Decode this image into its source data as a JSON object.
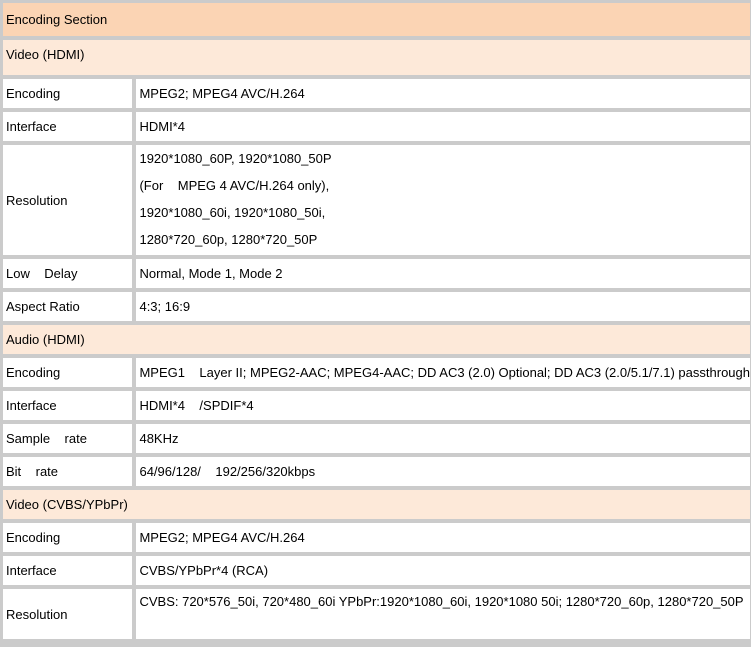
{
  "title": "Encoding Section",
  "sections": [
    {
      "heading": "Video (HDMI)",
      "rows": [
        {
          "label": "Encoding",
          "value": "MPEG2; MPEG4 AVC/H.264"
        },
        {
          "label": "Interface",
          "value": "HDMI*4"
        },
        {
          "label": "Resolution",
          "value_lines": [
            "1920*1080_60P, 1920*1080_50P",
            "(For    MPEG 4 AVC/H.264 only),",
            "1920*1080_60i, 1920*1080_50i,",
            "1280*720_60p, 1280*720_50P"
          ]
        },
        {
          "label": "Low    Delay",
          "value": "Normal, Mode 1, Mode 2"
        },
        {
          "label": "Aspect Ratio",
          "value": "4:3; 16:9"
        }
      ]
    },
    {
      "heading": "Audio (HDMI)",
      "rows": [
        {
          "label": "Encoding",
          "value": "MPEG1    Layer II; MPEG2-AAC; MPEG4-AAC; DD AC3 (2.0) Optional; DD AC3 (2.0/5.1/7.1) passthrough"
        },
        {
          "label": "Interface",
          "value": "HDMI*4    /SPDIF*4"
        },
        {
          "label": "Sample    rate",
          "value": "48KHz"
        },
        {
          "label": "Bit    rate",
          "value": "64/96/128/    192/256/320kbps"
        }
      ]
    },
    {
      "heading": "Video (CVBS/YPbPr)",
      "rows": [
        {
          "label": "Encoding",
          "value": "MPEG2; MPEG4 AVC/H.264"
        },
        {
          "label": "Interface",
          "value": "CVBS/YPbPr*4 (RCA)"
        },
        {
          "label": "Resolution",
          "value": "CVBS: 720*576_50i, 720*480_60i YPbPr:1920*1080_60i, 1920*1080 50i; 1280*720_60p, 1280*720_50P"
        }
      ]
    }
  ]
}
